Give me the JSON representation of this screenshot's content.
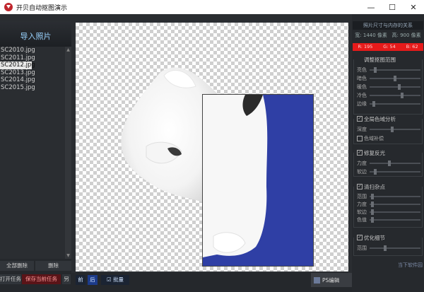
{
  "window": {
    "title": "开贝自动抠图演示",
    "minimize": "—",
    "maximize": "☐",
    "close": "✕"
  },
  "left": {
    "import_label": "导入照片",
    "files": [
      "SC2010.jpg",
      "SC2011.jpg",
      "SC2012.jpg",
      "SC2013.jpg",
      "SC2014.jpg",
      "SC2015.jpg"
    ],
    "selected_index": 2,
    "delete_all": "全部删除",
    "delete": "删除",
    "open_task": "打开任务",
    "save_task": "保存当前任务",
    "save_as": "另"
  },
  "toolbar": {
    "before": "前",
    "after": "后",
    "batch": "批量",
    "ps_edit": "PS编辑"
  },
  "right": {
    "header": "照片尺寸与内存的关系",
    "width_label": "宽: 1440 像素",
    "height_label": "高: 900 像素",
    "rgb": [
      "R: 195",
      "G: 54",
      "B: 62"
    ],
    "section_adjust": "调整抠图范围",
    "adjust_rows": [
      "亮色",
      "暗色",
      "暖色",
      "冷色",
      "边缘"
    ],
    "section_color": "全局色域分析",
    "color_rows": [
      "深度"
    ],
    "color_check": "色域补偿",
    "section_repair": "修复反光",
    "repair_rows": [
      "力度",
      "软边"
    ],
    "section_clean": "清扫杂点",
    "clean_rows": [
      "范围",
      "力度",
      "软边",
      "色值"
    ],
    "section_detail": "优化细节",
    "detail_rows": [
      "范围"
    ],
    "watermark": "当下软件园"
  },
  "colors": {
    "accent_blue": "#1b2fd6",
    "rgb_red": "#e61a1a",
    "photo_blue": "#2f3fa5"
  }
}
